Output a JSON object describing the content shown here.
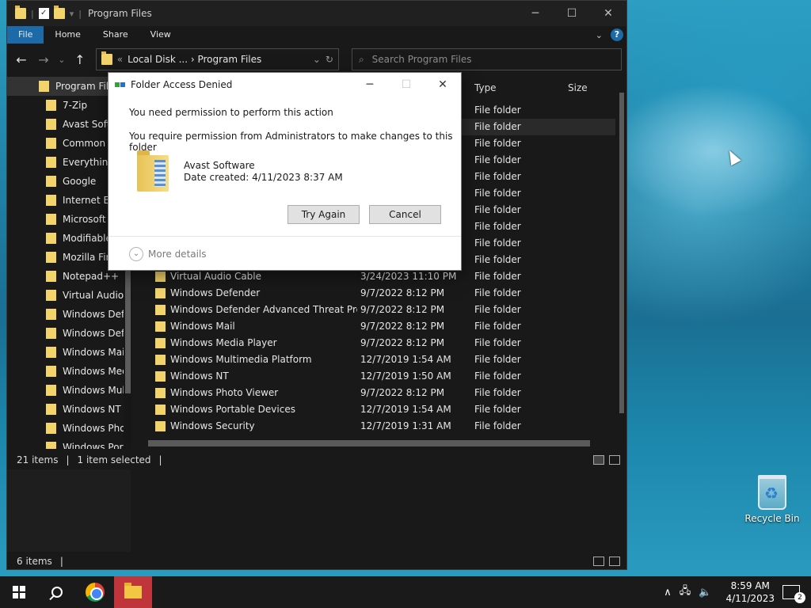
{
  "window": {
    "title": "Program Files",
    "qa_sep": "|",
    "minimize": "─",
    "maximize": "☐",
    "close": "✕"
  },
  "ribbon": {
    "tabs": [
      "File",
      "Home",
      "Share",
      "View"
    ],
    "help": "?"
  },
  "address": {
    "path": "Local Disk ... › Program Files",
    "chevron": "⌄"
  },
  "search": {
    "placeholder": "Search Program Files"
  },
  "nav": {
    "back": "←",
    "forward": "→",
    "recent": "⌄",
    "up": "↑",
    "refresh": "↻"
  },
  "tree": {
    "root": "Program Files",
    "items": [
      "7-Zip",
      "Avast Software",
      "Common Files",
      "Everything",
      "Google",
      "Internet Explorer",
      "Microsoft SQL",
      "ModifiableWin",
      "Mozilla Firefox",
      "Notepad++",
      "Virtual Audio Cable",
      "Windows Defender",
      "Windows Defender Advanced",
      "Windows Mail",
      "Windows Media Player",
      "Windows Multimedia",
      "Windows NT",
      "Windows Photo Viewer",
      "Windows Portable Devices"
    ]
  },
  "list": {
    "columns": {
      "type": "Type",
      "size": "Size"
    },
    "rows": [
      {
        "name": "",
        "date": "",
        "type": "File folder"
      },
      {
        "name": "",
        "date": "",
        "type": "File folder"
      },
      {
        "name": "",
        "date": "",
        "type": "File folder"
      },
      {
        "name": "",
        "date": "",
        "type": "File folder"
      },
      {
        "name": "",
        "date": "",
        "type": "File folder"
      },
      {
        "name": "",
        "date": "",
        "type": "File folder"
      },
      {
        "name": "",
        "date": "",
        "type": "File folder"
      },
      {
        "name": "",
        "date": "",
        "type": "File folder"
      },
      {
        "name": "",
        "date": "",
        "type": "File folder"
      },
      {
        "name": "",
        "date": "",
        "type": "File folder"
      },
      {
        "name": "Virtual Audio Cable",
        "date": "3/24/2023 11:10 PM",
        "type": "File folder"
      },
      {
        "name": "Windows Defender",
        "date": "9/7/2022 8:12 PM",
        "type": "File folder"
      },
      {
        "name": "Windows Defender Advanced Threat Prot...",
        "date": "9/7/2022 8:12 PM",
        "type": "File folder"
      },
      {
        "name": "Windows Mail",
        "date": "9/7/2022 8:12 PM",
        "type": "File folder"
      },
      {
        "name": "Windows Media Player",
        "date": "9/7/2022 8:12 PM",
        "type": "File folder"
      },
      {
        "name": "Windows Multimedia Platform",
        "date": "12/7/2019 1:54 AM",
        "type": "File folder"
      },
      {
        "name": "Windows NT",
        "date": "12/7/2019 1:50 AM",
        "type": "File folder"
      },
      {
        "name": "Windows Photo Viewer",
        "date": "9/7/2022 8:12 PM",
        "type": "File folder"
      },
      {
        "name": "Windows Portable Devices",
        "date": "12/7/2019 1:54 AM",
        "type": "File folder"
      },
      {
        "name": "Windows Security",
        "date": "12/7/2019 1:31 AM",
        "type": "File folder"
      }
    ]
  },
  "status": {
    "items_count": "21 items",
    "selected": "1 item selected",
    "sep": "|",
    "lower_items": "6 items"
  },
  "dialog": {
    "title": "Folder Access Denied",
    "minimize": "─",
    "maximize": "☐",
    "close": "✕",
    "message1": "You need permission to perform this action",
    "message2": "You require permission from Administrators to make changes to this folder",
    "folder_name": "Avast Software",
    "date_created": "Date created: 4/11/2023 8:37 AM",
    "try_again": "Try Again",
    "cancel": "Cancel",
    "more_details": "More details",
    "more_glyph": "⌄"
  },
  "desktop": {
    "recycle_bin": "Recycle Bin"
  },
  "taskbar": {
    "time": "8:59 AM",
    "date": "4/11/2023",
    "tray_up": "∧",
    "notifications": "2"
  }
}
